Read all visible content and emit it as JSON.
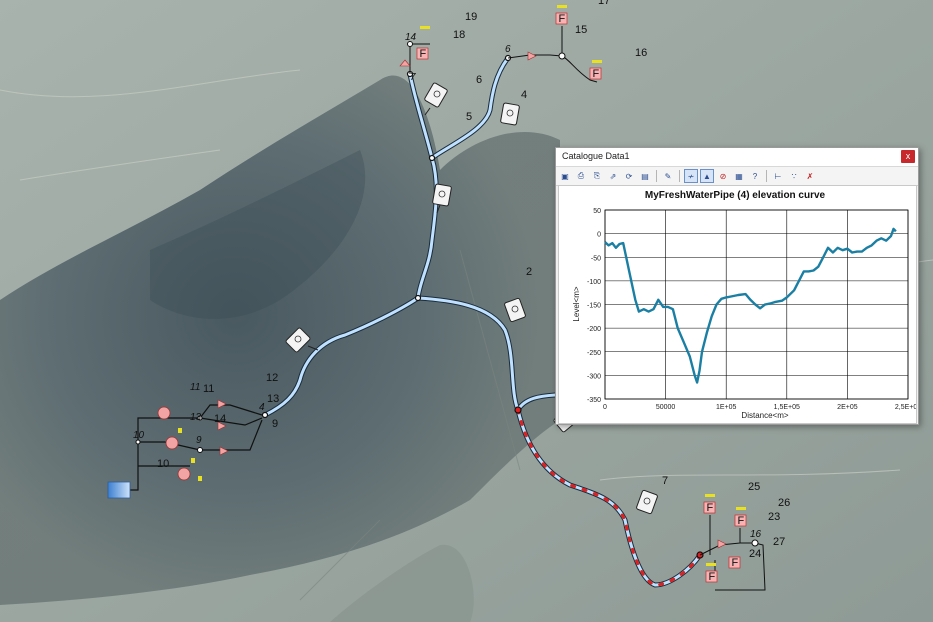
{
  "map": {
    "labels": [
      {
        "id": "19",
        "text": "19"
      },
      {
        "id": "18",
        "text": "18"
      },
      {
        "id": "17",
        "text": "17"
      },
      {
        "id": "15",
        "text": "15"
      },
      {
        "id": "16",
        "text": "16"
      },
      {
        "id": "6",
        "text": "6"
      },
      {
        "id": "4",
        "text": "4"
      },
      {
        "id": "5",
        "text": "5"
      },
      {
        "id": "2",
        "text": "2"
      },
      {
        "id": "12",
        "text": "12"
      },
      {
        "id": "13",
        "text": "13"
      },
      {
        "id": "9",
        "text": "9"
      },
      {
        "id": "11",
        "text": "11"
      },
      {
        "id": "14",
        "text": "14"
      },
      {
        "id": "10",
        "text": "10"
      },
      {
        "id": "7",
        "text": "7"
      },
      {
        "id": "25",
        "text": "25"
      },
      {
        "id": "26",
        "text": "26"
      },
      {
        "id": "23",
        "text": "23"
      },
      {
        "id": "24",
        "text": "24"
      },
      {
        "id": "27",
        "text": "27"
      }
    ],
    "italic_labels": [
      {
        "id": "14i",
        "text": "14"
      },
      {
        "id": "6i",
        "text": "6"
      },
      {
        "id": "7i",
        "text": "7"
      },
      {
        "id": "11i",
        "text": "11"
      },
      {
        "id": "13i",
        "text": "13"
      },
      {
        "id": "9i",
        "text": "9"
      },
      {
        "id": "10i",
        "text": "10"
      },
      {
        "id": "4i",
        "text": "4"
      },
      {
        "id": "16i",
        "text": "16"
      }
    ],
    "flag_label": "F"
  },
  "dialog": {
    "title": "Catalogue Data1",
    "close_label": "x",
    "toolbar": [
      "save",
      "print",
      "print-preview",
      "export",
      "refresh",
      "image",
      "edit",
      "chart",
      "chart-alt",
      "no-entry",
      "grid",
      "help",
      "axis",
      "series",
      "delete"
    ]
  },
  "chart_data": {
    "type": "line",
    "title": "MyFreshWaterPipe (4) elevation curve",
    "xlabel": "Distance<m>",
    "ylabel": "Level<m>",
    "xlim": [
      0,
      250000
    ],
    "ylim": [
      -350,
      50
    ],
    "xticks": [
      "0",
      "50000",
      "1E+05",
      "1,5E+05",
      "2E+05",
      "2,5E+05"
    ],
    "yticks": [
      "50",
      "0",
      "-50",
      "-100",
      "-150",
      "-200",
      "-250",
      "-300",
      "-350"
    ],
    "color": "#1a7fa3",
    "series": [
      {
        "x": [
          0,
          3000,
          6000,
          9000,
          12000,
          15000,
          20000,
          25000,
          28000,
          32000,
          36000,
          40000,
          44000,
          48000,
          52000,
          56000,
          60000,
          65000,
          70000,
          74000,
          76000,
          78000,
          80000,
          84000,
          88000,
          92000,
          96000,
          100000,
          104000,
          110000,
          116000,
          120000,
          124000,
          128000,
          132000,
          136000,
          140000,
          146000,
          150000,
          156000,
          160000,
          164000,
          168000,
          172000,
          176000,
          180000,
          184000,
          188000,
          192000,
          196000,
          200000,
          204000,
          208000,
          212000,
          216000,
          220000,
          224000,
          228000,
          232000,
          236000,
          238000,
          240000
        ],
        "y": [
          -18,
          -25,
          -20,
          -30,
          -22,
          -20,
          -80,
          -140,
          -165,
          -160,
          -165,
          -160,
          -140,
          -155,
          -155,
          -160,
          -200,
          -230,
          -260,
          -300,
          -315,
          -290,
          -250,
          -210,
          -175,
          -150,
          -138,
          -135,
          -133,
          -130,
          -128,
          -140,
          -150,
          -158,
          -150,
          -148,
          -145,
          -142,
          -135,
          -120,
          -100,
          -80,
          -80,
          -78,
          -70,
          -50,
          -30,
          -40,
          -30,
          -35,
          -32,
          -40,
          -38,
          -38,
          -30,
          -25,
          -15,
          -10,
          -15,
          -5,
          10,
          5
        ]
      }
    ]
  }
}
